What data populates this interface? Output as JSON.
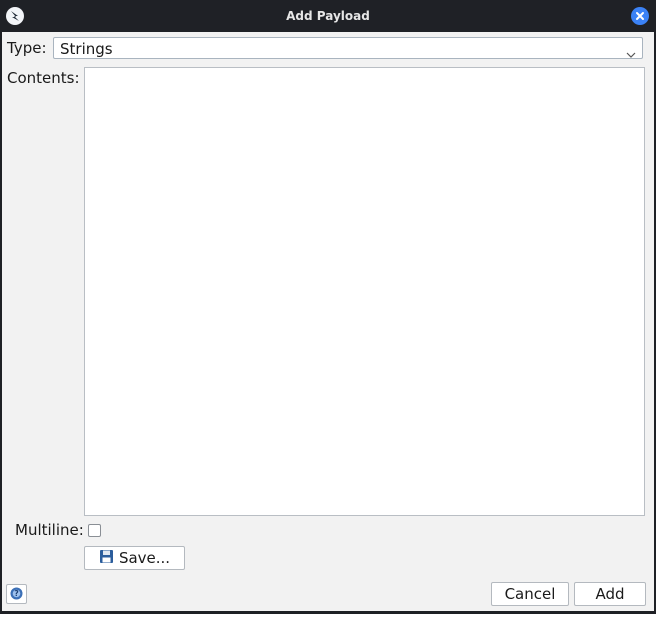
{
  "window": {
    "title": "Add Payload"
  },
  "icons": {
    "app": "burp-app-icon",
    "close": "close-icon",
    "dropdown": "chevron-down-icon",
    "save": "floppy-disk-icon",
    "help": "help-icon"
  },
  "form": {
    "type_label": "Type:",
    "type_value": "Strings",
    "contents_label": "Contents:",
    "contents_value": "",
    "multiline_label": "Multiline:",
    "multiline_checked": false,
    "save_label": "Save..."
  },
  "footer": {
    "cancel_label": "Cancel",
    "add_label": "Add"
  },
  "colors": {
    "titlebar": "#1f2126",
    "close_button": "#3b82f6",
    "panel": "#f2f2f2"
  }
}
